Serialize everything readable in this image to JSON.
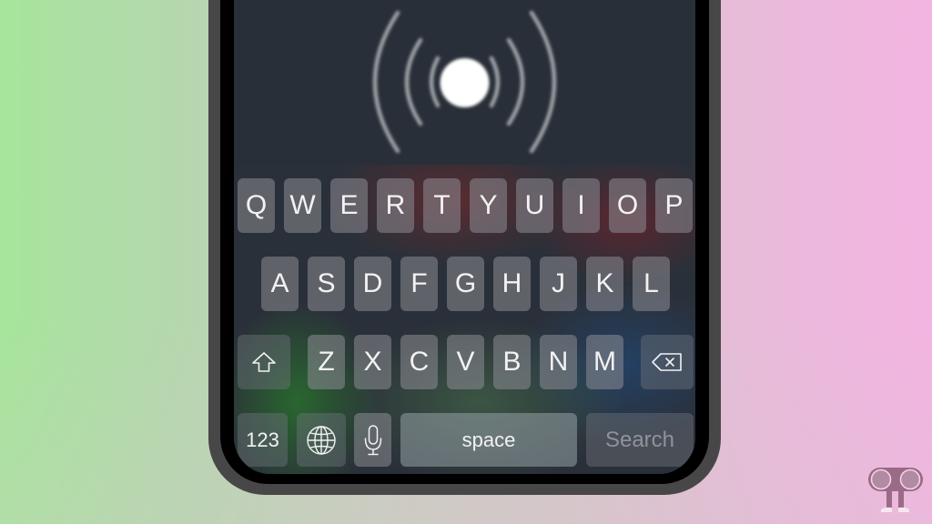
{
  "voice_indicator": {
    "icon": "siri-listening-icon",
    "state": "listening"
  },
  "keyboard": {
    "row1": [
      "Q",
      "W",
      "E",
      "R",
      "T",
      "Y",
      "U",
      "I",
      "O",
      "P"
    ],
    "row2": [
      "A",
      "S",
      "D",
      "F",
      "G",
      "H",
      "J",
      "K",
      "L"
    ],
    "row3": [
      "Z",
      "X",
      "C",
      "V",
      "B",
      "N",
      "M"
    ],
    "shift_icon": "shift-icon",
    "delete_icon": "delete-icon",
    "numbers_label": "123",
    "globe_icon": "globe-icon",
    "mic_icon": "microphone-icon",
    "space_label": "space",
    "search_label": "Search"
  },
  "colors": {
    "background_left": "#a6e59b",
    "background_right": "#f3b4e2",
    "screen": "#292f38",
    "key_text": "#f2f2f2",
    "search_text": "#8e939b",
    "logo": "#9a6a86"
  },
  "watermark": {
    "icon": "robot-eyes-logo-icon"
  }
}
